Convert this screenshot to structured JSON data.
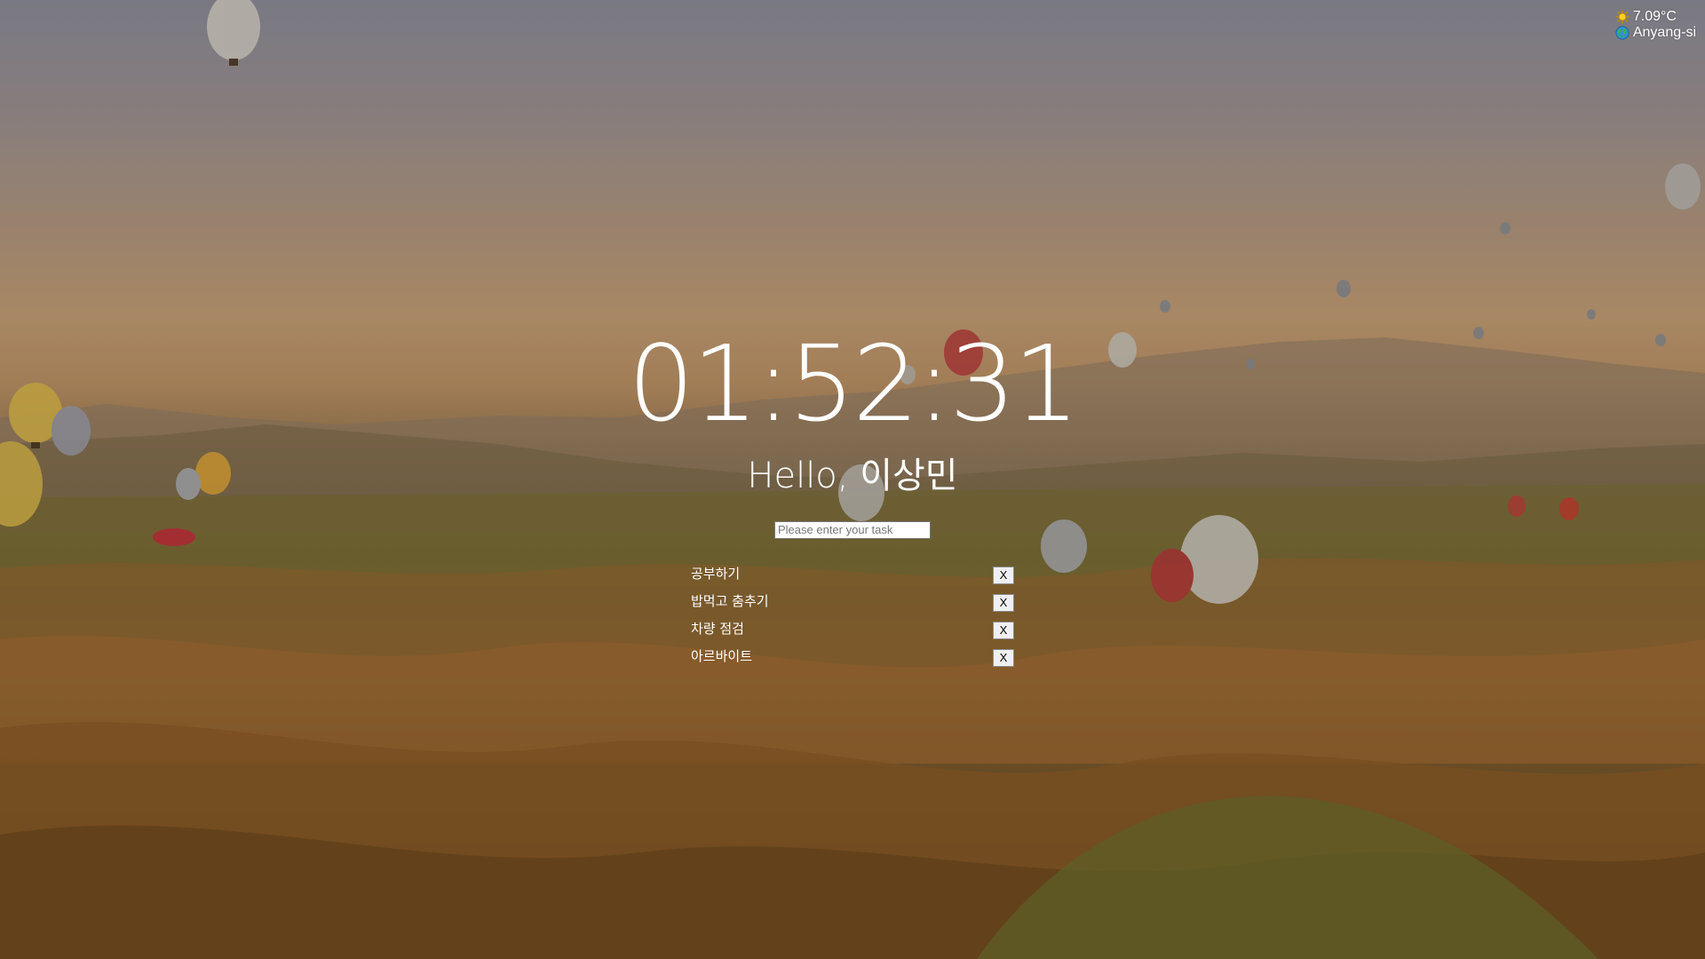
{
  "weather": {
    "temperature": "7.09°C",
    "city": "Anyang-si",
    "weather_icon": "sun-icon",
    "location_icon": "globe-icon"
  },
  "clock": {
    "time": "01:52:31"
  },
  "greeting": {
    "text": "Hello, 이상민"
  },
  "todo_form": {
    "placeholder": "Please enter your task",
    "value": ""
  },
  "todos": [
    {
      "text": "공부하기",
      "delete_label": "X"
    },
    {
      "text": "밥먹고 춤추기",
      "delete_label": "X"
    },
    {
      "text": "차량 점검",
      "delete_label": "X"
    },
    {
      "text": "아르바이트",
      "delete_label": "X"
    }
  ],
  "colors": {
    "text": "#ffffff",
    "sky_top": "#8a8a96",
    "sky_horizon": "#c09b72",
    "land": "#7a5a2e"
  }
}
